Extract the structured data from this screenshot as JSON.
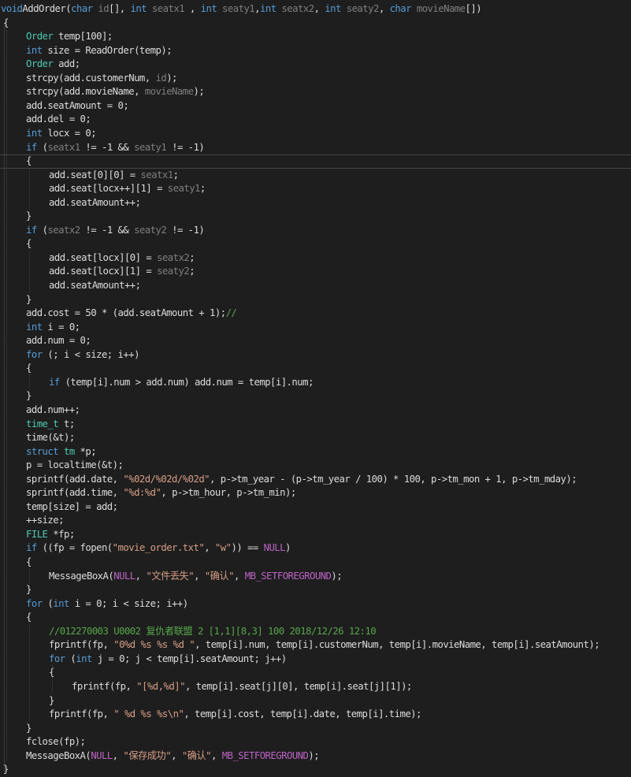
{
  "code_lines": [
    [
      [
        "kw",
        "void"
      ],
      [
        "",
        "AddOrder("
      ],
      [
        "kw",
        "char"
      ],
      [
        "pa",
        " id"
      ],
      [
        "",
        "[], "
      ],
      [
        "kw",
        "int"
      ],
      [
        "pa",
        " seatx1"
      ],
      [
        "",
        " , "
      ],
      [
        "kw",
        "int"
      ],
      [
        "pa",
        " seaty1"
      ],
      [
        "",
        ","
      ],
      [
        "kw",
        "int"
      ],
      [
        "pa",
        " seatx2"
      ],
      [
        "",
        ", "
      ],
      [
        "kw",
        "int"
      ],
      [
        "pa",
        " seaty2"
      ],
      [
        "",
        ", "
      ],
      [
        "kw",
        "char"
      ],
      [
        "pa",
        " movieName"
      ],
      [
        "",
        "[])"
      ]
    ],
    [
      [
        "",
        "{"
      ]
    ],
    [
      [
        "",
        ""
      ],
      [
        "ty",
        "Order"
      ],
      [
        "",
        " temp[100];"
      ]
    ],
    [
      [
        "",
        ""
      ],
      [
        "kw",
        "int"
      ],
      [
        "",
        " size = ReadOrder(temp);"
      ]
    ],
    [
      [
        "",
        ""
      ],
      [
        "ty",
        "Order"
      ],
      [
        "",
        " add;"
      ]
    ],
    [
      [
        "",
        "strcpy(add.customerNum, "
      ],
      [
        "pa",
        "id"
      ],
      [
        "",
        ");"
      ]
    ],
    [
      [
        "",
        "strcpy(add.movieName, "
      ],
      [
        "pa",
        "movieName"
      ],
      [
        "",
        ");"
      ]
    ],
    [
      [
        "",
        "add.seatAmount = 0;"
      ]
    ],
    [
      [
        "",
        "add.del = 0;"
      ]
    ],
    [
      [
        "",
        ""
      ],
      [
        "kw",
        "int"
      ],
      [
        "",
        " locx = 0;"
      ]
    ],
    [
      [
        "",
        ""
      ],
      [
        "kw",
        "if"
      ],
      [
        "",
        " ("
      ],
      [
        "pa",
        "seatx1"
      ],
      [
        "",
        " != -1 && "
      ],
      [
        "pa",
        "seaty1"
      ],
      [
        "",
        " != -1)"
      ]
    ],
    [
      [
        "",
        "{"
      ]
    ],
    [
      [
        "",
        "add.seat[0][0] = "
      ],
      [
        "pa",
        "seatx1"
      ],
      [
        "",
        ";"
      ]
    ],
    [
      [
        "",
        "add.seat[locx++][1] = "
      ],
      [
        "pa",
        "seaty1"
      ],
      [
        "",
        ";"
      ]
    ],
    [
      [
        "",
        "add.seatAmount++;"
      ]
    ],
    [
      [
        "",
        "}"
      ]
    ],
    [
      [
        "",
        ""
      ],
      [
        "kw",
        "if"
      ],
      [
        "",
        " ("
      ],
      [
        "pa",
        "seatx2"
      ],
      [
        "",
        " != -1 && "
      ],
      [
        "pa",
        "seaty2"
      ],
      [
        "",
        " != -1)"
      ]
    ],
    [
      [
        "",
        "{"
      ]
    ],
    [
      [
        "",
        "add.seat[locx][0] = "
      ],
      [
        "pa",
        "seatx2"
      ],
      [
        "",
        ";"
      ]
    ],
    [
      [
        "",
        "add.seat[locx][1] = "
      ],
      [
        "pa",
        "seaty2"
      ],
      [
        "",
        ";"
      ]
    ],
    [
      [
        "",
        "add.seatAmount++;"
      ]
    ],
    [
      [
        "",
        "}"
      ]
    ],
    [
      [
        "",
        "add.cost = 50 * (add.seatAmount + 1);"
      ],
      [
        "cm",
        "//"
      ]
    ],
    [
      [
        "",
        ""
      ],
      [
        "kw",
        "int"
      ],
      [
        "",
        " i = 0;"
      ]
    ],
    [
      [
        "",
        "add.num = 0;"
      ]
    ],
    [
      [
        "",
        ""
      ],
      [
        "kw",
        "for"
      ],
      [
        "",
        " (; i < size; i++)"
      ]
    ],
    [
      [
        "",
        "{"
      ]
    ],
    [
      [
        "",
        ""
      ],
      [
        "kw",
        "if"
      ],
      [
        "",
        " (temp[i].num > add.num) add.num = temp[i].num;"
      ]
    ],
    [
      [
        "",
        "}"
      ]
    ],
    [
      [
        "",
        "add.num++;"
      ]
    ],
    [
      [
        "",
        ""
      ],
      [
        "ty",
        "time_t"
      ],
      [
        "",
        " t;"
      ]
    ],
    [
      [
        "",
        "time(&t);"
      ]
    ],
    [
      [
        "",
        ""
      ],
      [
        "kw",
        "struct"
      ],
      [
        "",
        " "
      ],
      [
        "ty",
        "tm"
      ],
      [
        "",
        " *p;"
      ]
    ],
    [
      [
        "",
        "p = localtime(&t);"
      ]
    ],
    [
      [
        "",
        "sprintf(add.date, "
      ],
      [
        "st",
        "\"%02d/%02d/%02d\""
      ],
      [
        "",
        ", p->tm_year - (p->tm_year / 100) * 100, p->tm_mon + 1, p->tm_mday);"
      ]
    ],
    [
      [
        "",
        "sprintf(add.time, "
      ],
      [
        "st",
        "\"%d:%d\""
      ],
      [
        "",
        ", p->tm_hour, p->tm_min);"
      ]
    ],
    [
      [
        "",
        "temp[size] = add;"
      ]
    ],
    [
      [
        "",
        "++size;"
      ]
    ],
    [
      [
        "",
        ""
      ],
      [
        "ty",
        "FILE"
      ],
      [
        "",
        " *fp;"
      ]
    ],
    [
      [
        "",
        ""
      ],
      [
        "kw",
        "if"
      ],
      [
        "",
        " ((fp = fopen("
      ],
      [
        "st",
        "\"movie_order.txt\""
      ],
      [
        "",
        ", "
      ],
      [
        "st",
        "\"w\""
      ],
      [
        "",
        ")) == "
      ],
      [
        "mc",
        "NULL"
      ],
      [
        "",
        ")"
      ]
    ],
    [
      [
        "",
        "{"
      ]
    ],
    [
      [
        "",
        "MessageBoxA("
      ],
      [
        "mc",
        "NULL"
      ],
      [
        "",
        ", "
      ],
      [
        "st",
        "\"文件丢失\""
      ],
      [
        "",
        ", "
      ],
      [
        "st",
        "\"确认\""
      ],
      [
        "",
        ", "
      ],
      [
        "mc",
        "MB_SETFOREGROUND"
      ],
      [
        "",
        ");"
      ]
    ],
    [
      [
        "",
        "}"
      ]
    ],
    [
      [
        "",
        ""
      ],
      [
        "kw",
        "for"
      ],
      [
        "",
        " ("
      ],
      [
        "kw",
        "int"
      ],
      [
        "",
        " i = 0; i < size; i++)"
      ]
    ],
    [
      [
        "",
        "{"
      ]
    ],
    [
      [
        "cm",
        "//012270003 U0002 复仇者联盟 2 [1,1][8,3] 100 2018/12/26 12:10"
      ]
    ],
    [
      [
        "",
        "fprintf(fp, "
      ],
      [
        "st",
        "\"0%d %s %s %d \""
      ],
      [
        "",
        ", temp[i].num, temp[i].customerNum, temp[i].movieName, temp[i].seatAmount);"
      ]
    ],
    [
      [
        "",
        ""
      ],
      [
        "kw",
        "for"
      ],
      [
        "",
        " ("
      ],
      [
        "kw",
        "int"
      ],
      [
        "",
        " j = 0; j < temp[i].seatAmount; j++)"
      ]
    ],
    [
      [
        "",
        "{"
      ]
    ],
    [
      [
        "",
        "fprintf(fp, "
      ],
      [
        "st",
        "\"[%d,%d]\""
      ],
      [
        "",
        ", temp[i].seat[j][0], temp[i].seat[j][1]);"
      ]
    ],
    [
      [
        "",
        "}"
      ]
    ],
    [
      [
        "",
        "fprintf(fp, "
      ],
      [
        "st",
        "\" %d %s %s\\n\""
      ],
      [
        "",
        ", temp[i].cost, temp[i].date, temp[i].time);"
      ]
    ],
    [
      [
        "",
        "}"
      ]
    ],
    [
      [
        "",
        "fclose(fp);"
      ]
    ],
    [
      [
        "",
        "MessageBoxA("
      ],
      [
        "mc",
        "NULL"
      ],
      [
        "",
        ", "
      ],
      [
        "st",
        "\"保存成功\""
      ],
      [
        "",
        ", "
      ],
      [
        "st",
        "\"确认\""
      ],
      [
        "",
        ", "
      ],
      [
        "mc",
        "MB_SETFOREGROUND"
      ],
      [
        "",
        ");"
      ]
    ],
    [
      [
        "",
        "}"
      ]
    ]
  ],
  "colors": {
    "background": "#1e1e1e",
    "keyword": "#569cd6",
    "type": "#4ec9b0",
    "parameter": "#7f7f7f",
    "string": "#d69d85",
    "comment": "#57a64a",
    "macro": "#bd63c5",
    "text": "#dcdcdc"
  }
}
